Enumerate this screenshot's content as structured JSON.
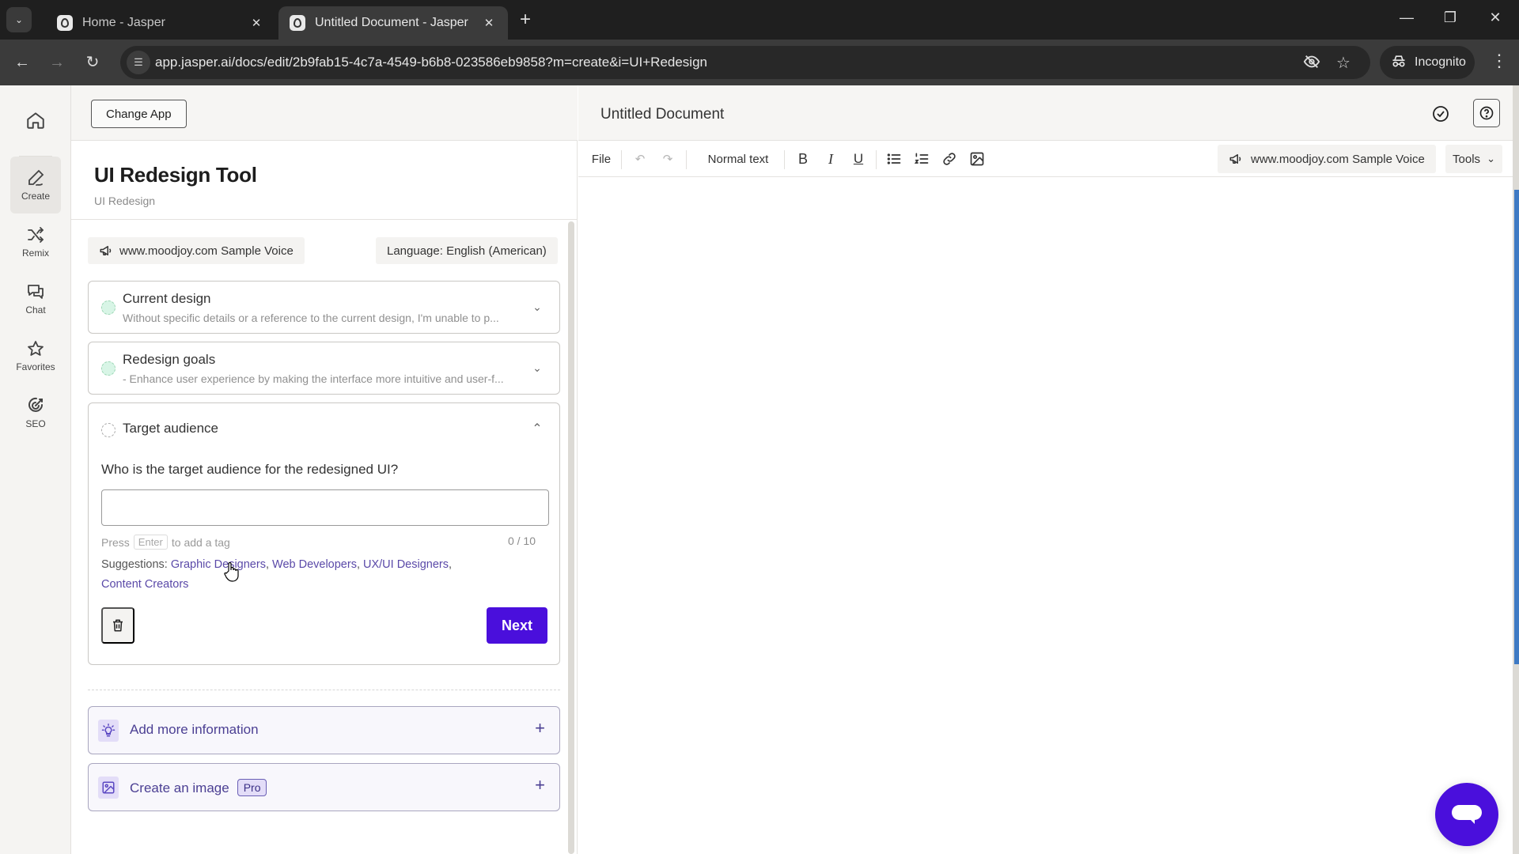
{
  "browser": {
    "tabs": [
      {
        "title": "Home - Jasper",
        "active": false
      },
      {
        "title": "Untitled Document - Jasper",
        "active": true
      }
    ],
    "url": "app.jasper.ai/docs/edit/2b9fab15-4c7a-4549-b6b8-023586eb9858?m=create&i=UI+Redesign",
    "profile_label": "Incognito"
  },
  "leftnav": {
    "items": [
      {
        "label": "Create",
        "icon": "pen-icon",
        "active": true
      },
      {
        "label": "Remix",
        "icon": "shuffle-icon",
        "active": false
      },
      {
        "label": "Chat",
        "icon": "chat-bubbles-icon",
        "active": false
      },
      {
        "label": "Favorites",
        "icon": "star-icon",
        "active": false
      },
      {
        "label": "SEO",
        "icon": "target-icon",
        "active": false
      }
    ]
  },
  "toolpanel": {
    "change_app_label": "Change App",
    "title": "UI Redesign Tool",
    "subtitle": "UI Redesign",
    "voice_chip": "www.moodjoy.com Sample Voice",
    "language_chip": "Language: English (American)",
    "sections": [
      {
        "title": "Current design",
        "description": "Without specific details or a reference to the current design, I'm unable to p...",
        "status": "complete",
        "expanded": false
      },
      {
        "title": "Redesign goals",
        "description": "- Enhance user experience by making the interface more intuitive and user-f...",
        "status": "complete",
        "expanded": false
      },
      {
        "title": "Target audience",
        "status": "pending",
        "expanded": true
      }
    ],
    "target_audience": {
      "question": "Who is the target audience for the redesigned UI?",
      "input_value": "",
      "hint_prefix": "Press",
      "hint_key": "Enter",
      "hint_suffix": "to add a tag",
      "counter": "0 / 10",
      "suggestions_label": "Suggestions:",
      "suggestions": [
        "Graphic Designers",
        "Web Developers",
        "UX/UI Designers",
        "Content Creators"
      ],
      "next_label": "Next"
    },
    "extras": [
      {
        "label": "Add more information",
        "icon": "lightbulb-icon",
        "badge": null
      },
      {
        "label": "Create an image",
        "icon": "image-icon",
        "badge": "Pro"
      }
    ]
  },
  "editor": {
    "doc_title": "Untitled Document",
    "toolbar": {
      "file_label": "File",
      "text_style": "Normal text",
      "voice_chip": "www.moodjoy.com Sample Voice",
      "tools_label": "Tools"
    },
    "body_text": ""
  },
  "colors": {
    "accent": "#4a0fdc",
    "link": "#5a49a8",
    "complete_dot": "#d8f5e6"
  }
}
